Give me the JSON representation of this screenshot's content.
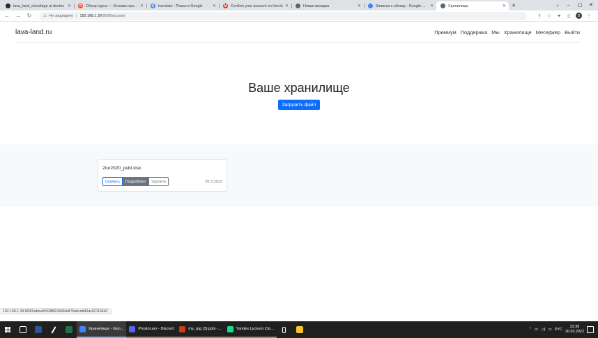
{
  "browser": {
    "tabs": [
      {
        "title": "lava_land_cloud/app at docker",
        "favicon": "github-icon",
        "color": "#24292f",
        "glyph": ""
      },
      {
        "title": "Обзор курса — Основы програ",
        "favicon": "yandex-icon",
        "color": "#fc3f1d",
        "glyph": "Я"
      },
      {
        "title": "translate - Поиск в Google",
        "favicon": "google-icon",
        "color": "#4285f4",
        "glyph": "G"
      },
      {
        "title": "Confirm your account on Herok",
        "favicon": "gmail-icon",
        "color": "#d93025",
        "glyph": "M"
      },
      {
        "title": "Новая вкладка",
        "favicon": "chrome-icon",
        "color": "#5f6368",
        "glyph": ""
      },
      {
        "title": "Записка к облаку - Google Док",
        "favicon": "google-docs-icon",
        "color": "#4285f4",
        "glyph": ""
      },
      {
        "title": "Хранилище",
        "favicon": "globe-icon",
        "color": "#5f6368",
        "glyph": ""
      }
    ],
    "active_tab": 6,
    "security_label": "Не защищено",
    "url_host": "192.168.1.39",
    "url_path": ":8000/account",
    "profile_initial": "D",
    "status_url": "192.168.1.39:8000/about/50288019684d475abcdd40ac921146d2"
  },
  "site": {
    "brand": "lava-land.ru",
    "nav": [
      "Премиум",
      "Поддержка",
      "Мы",
      "Хранилище",
      "Меседжер",
      "Выйти"
    ],
    "heading": "Ваше хранилище",
    "upload_label": "Загрузить файл",
    "file": {
      "name": "2tur2020_publ.xlsx",
      "download_label": "Скачать",
      "details_label": "Подробнее",
      "delete_label": "Удалить",
      "date": "26.3.2022"
    }
  },
  "taskbar": {
    "apps": [
      {
        "label": "Хранилище - Goo...",
        "icon": "chrome-icon",
        "color": "#4285f4",
        "state": "active"
      },
      {
        "label": "ProstoLavr - Discord",
        "icon": "discord-icon",
        "color": "#5865f2",
        "state": "open"
      },
      {
        "label": "my_rpg (3).pptx -...",
        "icon": "powerpoint-icon",
        "color": "#c43e1c",
        "state": "open"
      },
      {
        "label": "Yandex.Lyceum.Clo...",
        "icon": "pycharm-icon",
        "color": "#21d789",
        "state": "open"
      }
    ],
    "language": "РУС",
    "time": "22:38",
    "date": "26.03.2022"
  }
}
